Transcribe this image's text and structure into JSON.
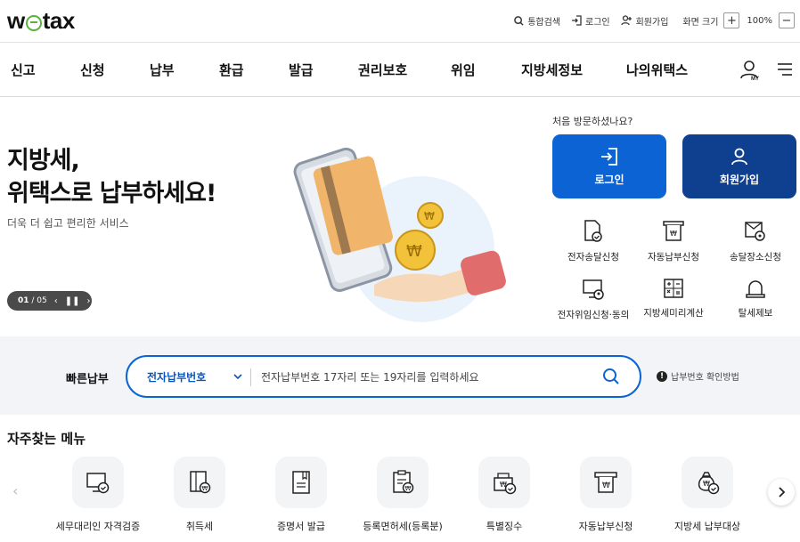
{
  "logo": {
    "pre": "w",
    "post": "tax"
  },
  "utils": {
    "search": "통합검색",
    "login": "로그인",
    "join": "회원가입",
    "zoom_label": "화면 크기",
    "zoom_in": "+",
    "zoom_value": "100%",
    "zoom_out": "−"
  },
  "nav": {
    "items": [
      "신고",
      "신청",
      "납부",
      "환급",
      "발급",
      "권리보호",
      "위임",
      "지방세정보",
      "나의위택스"
    ],
    "my_label": "MY"
  },
  "hero": {
    "title_line1": "지방세,",
    "title_line2": "위택스로 납부하세요!",
    "subtitle": "더욱 더 쉽고 편리한 서비스",
    "slide_current": "01",
    "slide_total": "/ 05"
  },
  "side": {
    "visit_question": "처음 방문하셨나요?",
    "login_label": "로그인",
    "join_label": "회원가입",
    "services": [
      "전자송달신청",
      "자동납부신청",
      "송달장소신청",
      "전자위임신청·동의",
      "지방세미리계산",
      "탈세제보"
    ]
  },
  "quick": {
    "label": "빠른납부",
    "select_value": "전자납부번호",
    "placeholder": "전자납부번호 17자리 또는 19자리를 입력하세요",
    "help": "납부번호 확인방법"
  },
  "frequent": {
    "title": "자주찾는 메뉴",
    "items": [
      "세무대리인 자격검증",
      "취득세",
      "증명서 발급",
      "등록면허세(등록분)",
      "특별징수",
      "자동납부신청",
      "지방세 납부대상"
    ]
  },
  "colors": {
    "primary": "#0c64d4",
    "dark_primary": "#0f3f8f",
    "logo_green": "#59b33c"
  }
}
